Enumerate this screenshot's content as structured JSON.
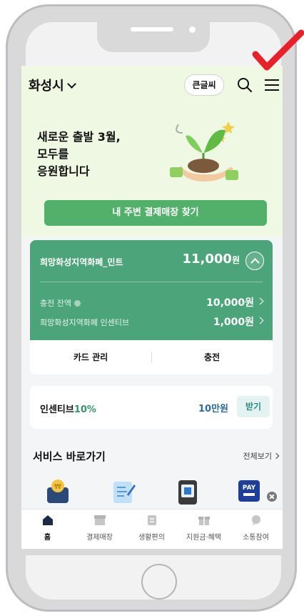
{
  "header": {
    "city": "화성시",
    "big_font_label": "큰글씨"
  },
  "hero": {
    "headline": "새로운 출발 3월,\n모두를\n응원합니다",
    "find_store_button": "내 주변 결제매장 찾기"
  },
  "card": {
    "name": "희망화성지역화폐_민트",
    "amount": "11,000",
    "amount_unit": "원",
    "rows": [
      {
        "label": "충전 잔액",
        "value": "10,000원"
      },
      {
        "label": "희망화성지역화폐 인센티브",
        "value": "1,000원"
      }
    ],
    "actions": [
      "카드 관리",
      "충전"
    ]
  },
  "incentive": {
    "label": "인센티브",
    "percent": "10%",
    "amount": "10만원",
    "receive_button": "받기"
  },
  "services": {
    "title": "서비스 바로가기",
    "view_all": "전체보기",
    "icons": [
      "wallet-icon",
      "document-edit-icon",
      "phone-card-icon",
      "pay-icon"
    ],
    "pay_label": "PAY"
  },
  "bottom_nav": [
    {
      "label": "홈",
      "icon": "home-icon",
      "active": true
    },
    {
      "label": "결제매장",
      "icon": "store-icon",
      "active": false
    },
    {
      "label": "생활편의",
      "icon": "life-icon",
      "active": false
    },
    {
      "label": "지원금·혜택",
      "icon": "gift-icon",
      "active": false
    },
    {
      "label": "소통참여",
      "icon": "chat-icon",
      "active": false
    }
  ],
  "colors": {
    "accent_green": "#4ca47a",
    "button_green": "#53b06b",
    "hero_bg": "#eef8e2",
    "annotation_red": "#e8202a"
  }
}
